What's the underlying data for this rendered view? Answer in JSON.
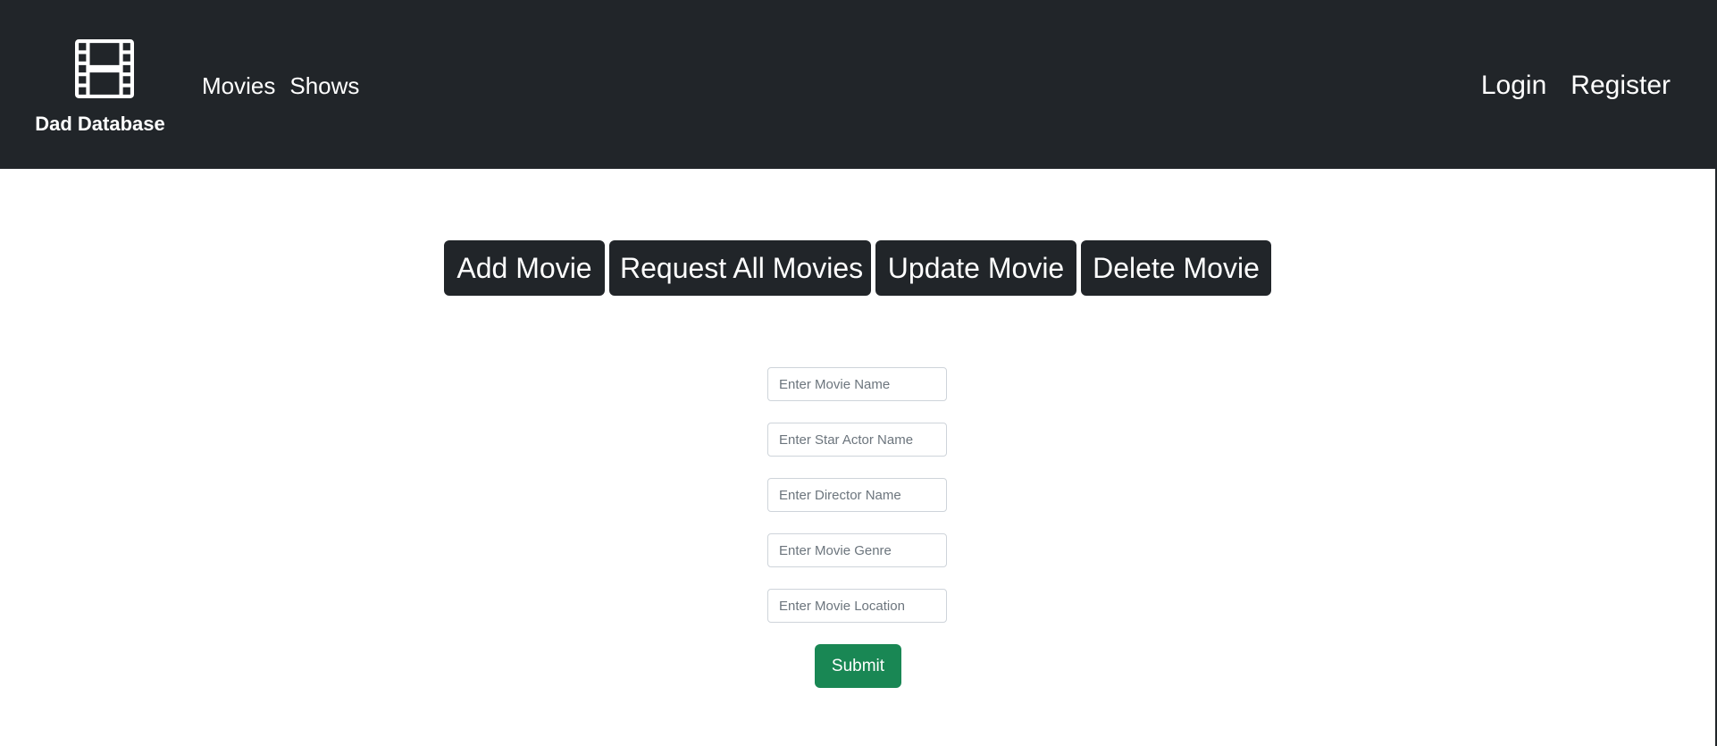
{
  "navbar": {
    "brand": {
      "name": "Dad Database",
      "icon": "film-icon"
    },
    "left_links": [
      {
        "label": "Movies"
      },
      {
        "label": "Shows"
      }
    ],
    "right_links": [
      {
        "label": "Login"
      },
      {
        "label": "Register"
      }
    ],
    "background_color": "#212529"
  },
  "actions": [
    {
      "label": "Add Movie"
    },
    {
      "label": "Request All Movies"
    },
    {
      "label": "Update Movie"
    },
    {
      "label": "Delete Movie"
    }
  ],
  "form": {
    "fields": [
      {
        "placeholder": "Enter Movie Name",
        "value": ""
      },
      {
        "placeholder": "Enter Star Actor Name",
        "value": ""
      },
      {
        "placeholder": "Enter Director Name",
        "value": ""
      },
      {
        "placeholder": "Enter Movie Genre",
        "value": ""
      },
      {
        "placeholder": "Enter Movie Location",
        "value": ""
      }
    ],
    "submit_label": "Submit",
    "submit_color": "#198754"
  }
}
